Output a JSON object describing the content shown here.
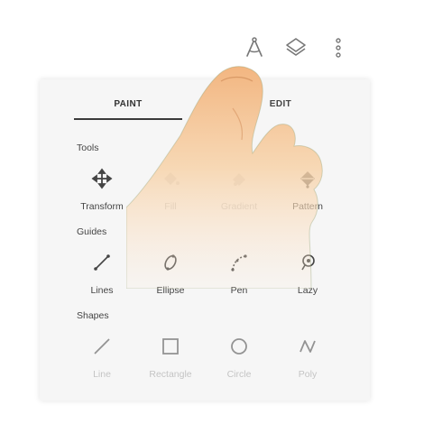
{
  "toolbar": {
    "icons": [
      "compass-icon",
      "layers-icon",
      "more-vert-icon"
    ]
  },
  "tabs": [
    {
      "label": "PAINT",
      "active": true
    },
    {
      "label": "EDIT",
      "active": false
    }
  ],
  "sections": {
    "tools": {
      "title": "Tools",
      "items": [
        {
          "label": "Transform",
          "icon": "move-arrows-icon"
        },
        {
          "label": "Fill",
          "icon": "paint-bucket-icon"
        },
        {
          "label": "Gradient",
          "icon": "gradient-bucket-icon"
        },
        {
          "label": "Pattern",
          "icon": "pattern-bucket-icon"
        }
      ]
    },
    "guides": {
      "title": "Guides",
      "items": [
        {
          "label": "Lines",
          "icon": "line-guide-icon"
        },
        {
          "label": "Ellipse",
          "icon": "ellipse-guide-icon"
        },
        {
          "label": "Pen",
          "icon": "pen-guide-icon"
        },
        {
          "label": "Lazy",
          "icon": "lazy-guide-icon"
        }
      ]
    },
    "shapes": {
      "title": "Shapes",
      "items": [
        {
          "label": "Line",
          "icon": "line-shape-icon"
        },
        {
          "label": "Rectangle",
          "icon": "rectangle-shape-icon"
        },
        {
          "label": "Circle",
          "icon": "circle-shape-icon"
        },
        {
          "label": "Poly",
          "icon": "poly-shape-icon"
        }
      ]
    }
  },
  "colors": {
    "panel_bg": "#f6f6f6",
    "icon": "#555555",
    "hand_fill": "#f5c38f"
  }
}
